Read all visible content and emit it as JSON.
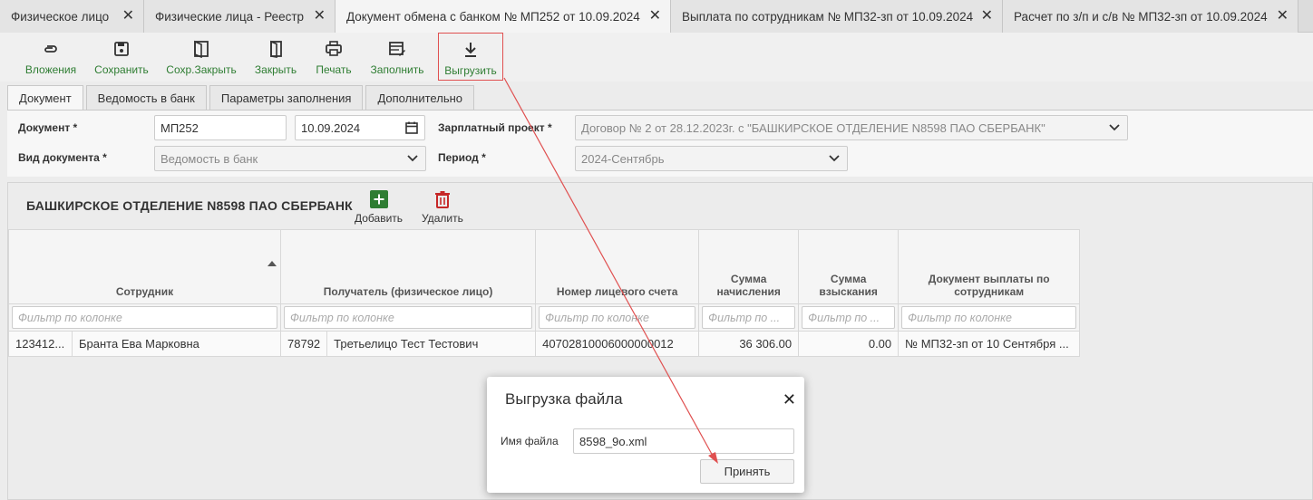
{
  "tabs": [
    {
      "label": "Физическое лицо"
    },
    {
      "label": "Физические лица - Реестр"
    },
    {
      "label": "Документ обмена с банком № МП252 от 10.09.2024"
    },
    {
      "label": "Выплата по сотрудникам № МП32-зп от 10.09.2024"
    },
    {
      "label": "Расчет по з/п и с/в № МП32-зп от 10.09.2024"
    }
  ],
  "toolbar": {
    "attachments": "Вложения",
    "save": "Сохранить",
    "save_close": "Сохр.Закрыть",
    "close": "Закрыть",
    "print": "Печать",
    "fill": "Заполнить",
    "export": "Выгрузить"
  },
  "section_tabs": [
    "Документ",
    "Ведомость в банк",
    "Параметры заполнения",
    "Дополнительно"
  ],
  "form": {
    "doc_label": "Документ *",
    "doc_number": "МП252",
    "doc_date": "10.09.2024",
    "doc_type_label": "Вид документа *",
    "doc_type_value": "Ведомость в банк",
    "salary_project_label": "Зарплатный проект *",
    "salary_project_value": "Договор № 2 от 28.12.2023г. с \"БАШКИРСКОЕ ОТДЕЛЕНИЕ N8598 ПАО СБЕРБАНК\"",
    "period_label": "Период *",
    "period_value": "2024-Сентябрь"
  },
  "grid": {
    "title": "БАШКИРСКОЕ ОТДЕЛЕНИЕ N8598 ПАО СБЕРБАНК",
    "add_label": "Добавить",
    "delete_label": "Удалить",
    "columns": [
      "Сотрудник",
      "Получатель (физическое лицо)",
      "Номер лицевого счета",
      "Сумма начисления",
      "Сумма взыскания",
      "Документ выплаты по сотрудникам"
    ],
    "filters": [
      "Фильтр по колонке",
      "Фильтр по колонке",
      "Фильтр по колонке",
      "Фильтр по ...",
      "Фильтр по ...",
      "Фильтр по колонке"
    ],
    "row": {
      "emp_code": "123412...",
      "emp_name": "Бранта Ева Марковна",
      "rec_code": "78792",
      "rec_name": "Третьелицо Тест Тестович",
      "account": "40702810006000000012",
      "accrual": "36 306.00",
      "deduction": "0.00",
      "payment_doc": "№ МП32-зп от 10 Сентября ..."
    }
  },
  "dialog": {
    "title": "Выгрузка файла",
    "file_label": "Имя файла",
    "file_value": "8598_9o.xml",
    "accept": "Принять"
  },
  "colors": {
    "accent_green": "#2e7d32",
    "delete_red": "#c62828",
    "annotation_red": "#e05050"
  }
}
